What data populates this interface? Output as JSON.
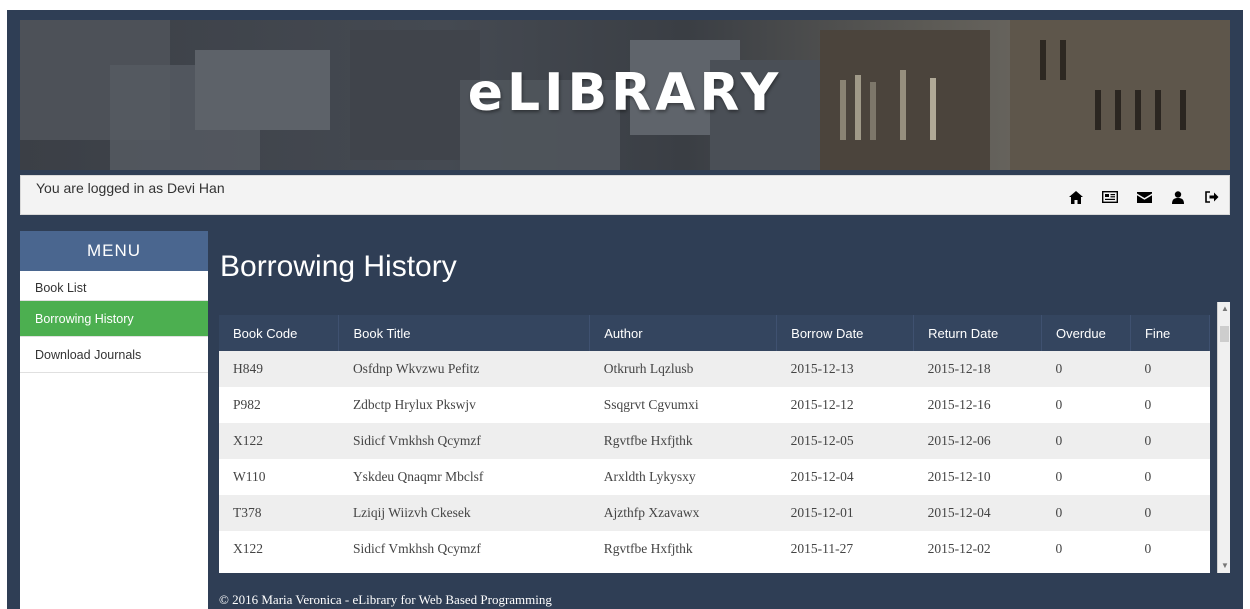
{
  "app": {
    "title": "eLIBRARY",
    "logged_in_message": "You are logged in as Devi Han"
  },
  "nav_icons": [
    "home-icon",
    "newspaper-icon",
    "envelope-icon",
    "user-icon",
    "logout-icon"
  ],
  "menu": {
    "title": "MENU",
    "items": [
      {
        "label": "Book List",
        "active": false
      },
      {
        "label": "Borrowing History",
        "active": true
      },
      {
        "label": "Download Journals",
        "active": false
      }
    ]
  },
  "page": {
    "title": "Borrowing History"
  },
  "table": {
    "columns": [
      "Book Code",
      "Book Title",
      "Author",
      "Borrow Date",
      "Return Date",
      "Overdue",
      "Fine"
    ],
    "rows": [
      [
        "H849",
        "Osfdnp Wkvzwu Pefitz",
        "Otkrurh Lqzlusb",
        "2015-12-13",
        "2015-12-18",
        "0",
        "0"
      ],
      [
        "P982",
        "Zdbctp Hrylux Pkswjv",
        "Ssqgrvt Cgvumxi",
        "2015-12-12",
        "2015-12-16",
        "0",
        "0"
      ],
      [
        "X122",
        "Sidicf Vmkhsh Qcymzf",
        "Rgvtfbe Hxfjthk",
        "2015-12-05",
        "2015-12-06",
        "0",
        "0"
      ],
      [
        "W110",
        "Yskdeu Qnaqmr Mbclsf",
        "Arxldth Lykysxy",
        "2015-12-04",
        "2015-12-10",
        "0",
        "0"
      ],
      [
        "T378",
        "Lziqij Wiizvh Ckesek",
        "Ajzthfp Xzavawx",
        "2015-12-01",
        "2015-12-04",
        "0",
        "0"
      ],
      [
        "X122",
        "Sidicf Vmkhsh Qcymzf",
        "Rgvtfbe Hxfjthk",
        "2015-11-27",
        "2015-12-02",
        "0",
        "0"
      ]
    ]
  },
  "footer": {
    "text": "© 2016 Maria Veronica - eLibrary for Web Based Programming"
  },
  "colors": {
    "frame": "#2f3e55",
    "menu_header": "#4a668f",
    "active_item": "#4caf50",
    "table_header": "#34455f"
  }
}
